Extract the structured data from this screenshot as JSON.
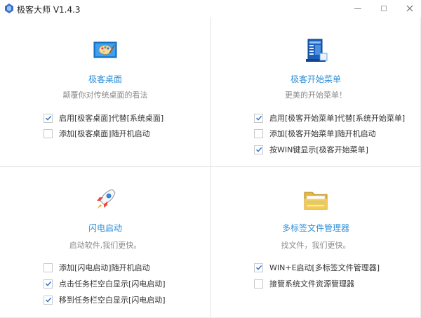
{
  "window": {
    "title": "极客大师 V1.4.3",
    "icon": "app-logo-icon"
  },
  "colors": {
    "accent": "#2f8fd8",
    "check": "#2f6fcf",
    "divider": "#e3e3e3"
  },
  "panels": [
    {
      "icon": "desktop-painting-icon",
      "title": "极客桌面",
      "subtitle": "颠覆你对传统桌面的看法",
      "options": [
        {
          "label": "启用[极客桌面]代替[系统桌面]",
          "checked": true
        },
        {
          "label": "添加[极客桌面]随开机启动",
          "checked": false
        }
      ]
    },
    {
      "icon": "start-menu-icon",
      "title": "极客开始菜单",
      "subtitle": "更美的开始菜单！",
      "options": [
        {
          "label": "启用[极客开始菜单]代替[系统开始菜单]",
          "checked": true
        },
        {
          "label": "添加[极客开始菜单]随开机启动",
          "checked": false
        },
        {
          "label": "按WIN键显示[极客开始菜单]",
          "checked": true
        }
      ]
    },
    {
      "icon": "rocket-icon",
      "title": "闪电启动",
      "subtitle": "启动软件,我们更快。",
      "options": [
        {
          "label": "添加[闪电启动]随开机启动",
          "checked": false
        },
        {
          "label": "点击任务栏空白显示[闪电启动]",
          "checked": true
        },
        {
          "label": "移到任务栏空白显示[闪电启动]",
          "checked": true
        }
      ]
    },
    {
      "icon": "folder-tabs-icon",
      "title": "多标签文件管理器",
      "subtitle": "找文件，我们更快。",
      "options": [
        {
          "label": "WIN+E启动[多标签文件管理器]",
          "checked": true
        },
        {
          "label": "接管系统文件资源管理器",
          "checked": false
        }
      ]
    }
  ]
}
